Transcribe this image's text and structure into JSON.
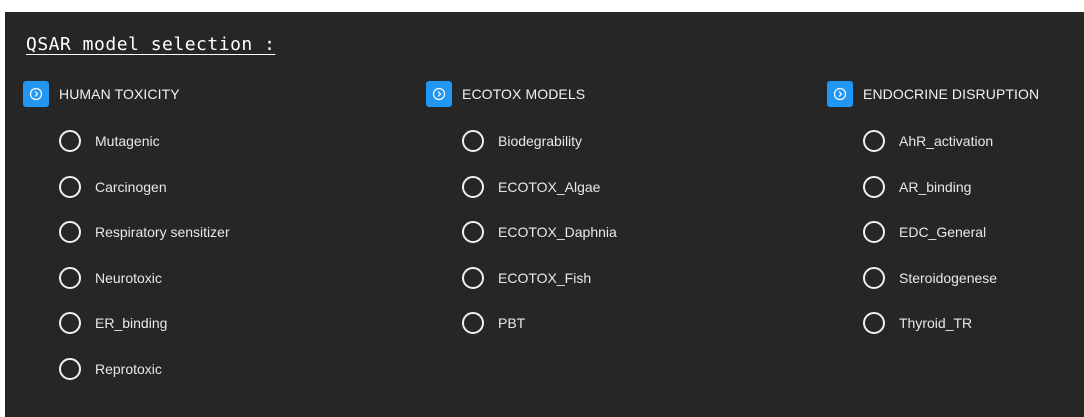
{
  "title": "QSAR model selection :",
  "colors": {
    "panel_bg": "#262626",
    "accent": "#2196f3",
    "text": "#ffffff"
  },
  "groups": [
    {
      "label": "HUMAN TOXICITY",
      "icon": "expand-circle-icon",
      "options": [
        "Mutagenic",
        "Carcinogen",
        "Respiratory sensitizer",
        "Neurotoxic",
        "ER_binding",
        "Reprotoxic"
      ]
    },
    {
      "label": "ECOTOX MODELS",
      "icon": "expand-circle-icon",
      "options": [
        "Biodegrability",
        "ECOTOX_Algae",
        "ECOTOX_Daphnia",
        "ECOTOX_Fish",
        "PBT"
      ]
    },
    {
      "label": "ENDOCRINE DISRUPTION",
      "icon": "expand-circle-icon",
      "options": [
        "AhR_activation",
        "AR_binding",
        "EDC_General",
        "Steroidogenese",
        "Thyroid_TR"
      ]
    }
  ]
}
